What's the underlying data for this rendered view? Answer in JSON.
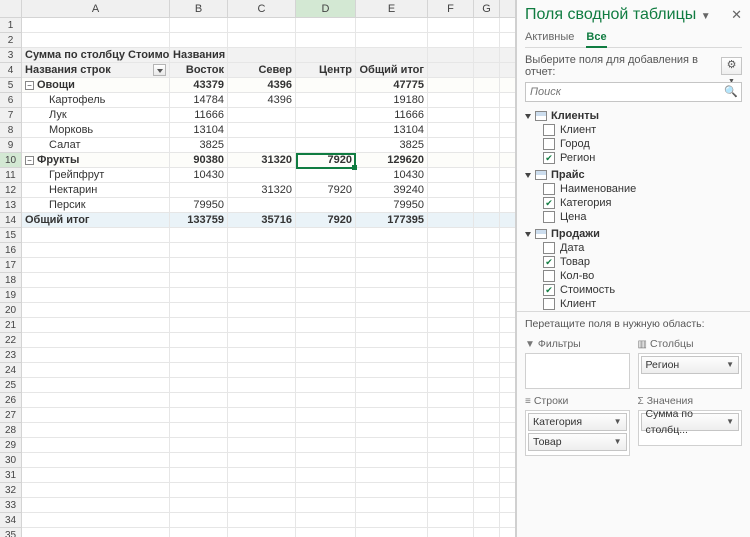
{
  "columns": [
    "A",
    "B",
    "C",
    "D",
    "E",
    "F",
    "G"
  ],
  "selected": {
    "col": "D",
    "row": 10
  },
  "pivot": {
    "value_field_label": "Сумма по столбцу Стоимость",
    "col_field_label": "Названия с",
    "row_field_label": "Названия строк",
    "col_headers": [
      "Восток",
      "Север",
      "Центр",
      "Общий итог"
    ]
  },
  "rows": [
    {
      "type": "group",
      "label": "Овощи",
      "vals": [
        "43379",
        "4396",
        "",
        "47775"
      ]
    },
    {
      "type": "item",
      "label": "Картофель",
      "vals": [
        "14784",
        "4396",
        "",
        "19180"
      ]
    },
    {
      "type": "item",
      "label": "Лук",
      "vals": [
        "11666",
        "",
        "",
        "11666"
      ]
    },
    {
      "type": "item",
      "label": "Морковь",
      "vals": [
        "13104",
        "",
        "",
        "13104"
      ]
    },
    {
      "type": "item",
      "label": "Салат",
      "vals": [
        "3825",
        "",
        "",
        "3825"
      ]
    },
    {
      "type": "group",
      "label": "Фрукты",
      "vals": [
        "90380",
        "31320",
        "7920",
        "129620"
      ]
    },
    {
      "type": "item",
      "label": "Грейпфрут",
      "vals": [
        "10430",
        "",
        "",
        "10430"
      ]
    },
    {
      "type": "item",
      "label": "Нектарин",
      "vals": [
        "",
        "31320",
        "7920",
        "39240"
      ]
    },
    {
      "type": "item",
      "label": "Персик",
      "vals": [
        "79950",
        "",
        "",
        "79950"
      ]
    },
    {
      "type": "grand",
      "label": "Общий итог",
      "vals": [
        "133759",
        "35716",
        "7920",
        "177395"
      ]
    }
  ],
  "panel": {
    "title": "Поля сводной таблицы",
    "tabs": {
      "active": "Активные",
      "all": "Все"
    },
    "subtitle": "Выберите поля для добавления в отчет:",
    "search_placeholder": "Поиск",
    "groups": [
      {
        "name": "Клиенты",
        "fields": [
          {
            "n": "Клиент",
            "c": false
          },
          {
            "n": "Город",
            "c": false
          },
          {
            "n": "Регион",
            "c": true
          }
        ]
      },
      {
        "name": "Прайс",
        "fields": [
          {
            "n": "Наименование",
            "c": false
          },
          {
            "n": "Категория",
            "c": true
          },
          {
            "n": "Цена",
            "c": false
          }
        ]
      },
      {
        "name": "Продажи",
        "fields": [
          {
            "n": "Дата",
            "c": false
          },
          {
            "n": "Товар",
            "c": true
          },
          {
            "n": "Кол-во",
            "c": false
          },
          {
            "n": "Стоимость",
            "c": true
          },
          {
            "n": "Клиент",
            "c": false
          }
        ]
      }
    ],
    "drag_hint": "Перетащите поля в нужную область:",
    "zones": {
      "filters": {
        "label": "Фильтры",
        "items": []
      },
      "columns": {
        "label": "Столбцы",
        "items": [
          "Регион"
        ]
      },
      "rows": {
        "label": "Строки",
        "items": [
          "Категория",
          "Товар"
        ]
      },
      "values": {
        "label": "Значения",
        "items": [
          "Сумма по столбц..."
        ]
      }
    }
  }
}
